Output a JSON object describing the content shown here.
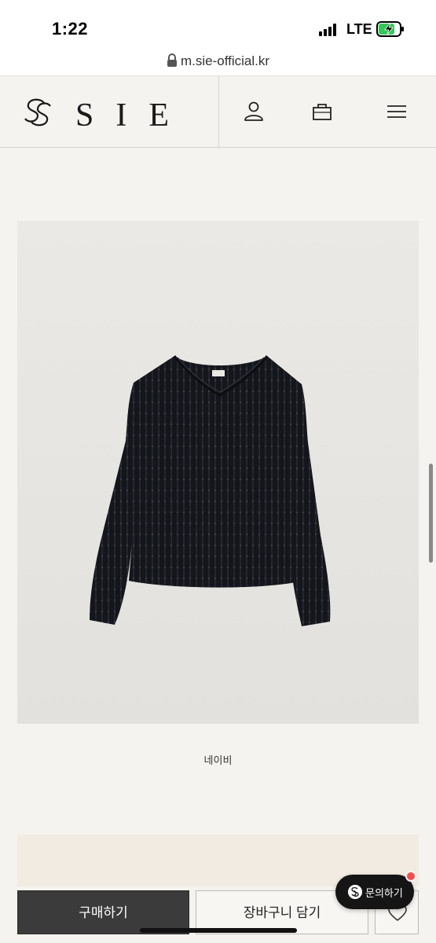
{
  "status_bar": {
    "time": "1:22",
    "network": "LTE",
    "icons": [
      "signal-icon",
      "battery-charging-icon"
    ]
  },
  "browser": {
    "url": "m.sie-official.kr",
    "icons": [
      "lock-icon"
    ]
  },
  "header": {
    "brand_name": "SIE",
    "icons": [
      "brand-logo-icon",
      "account-icon",
      "shopping-bag-icon",
      "menu-icon"
    ]
  },
  "product": {
    "image_icon": "navy-knit-sweater-photo",
    "color_label": "네이비"
  },
  "actions": {
    "buy_label": "구매하기",
    "cart_label": "장바구니 담기",
    "wishlist_icon": "heart-icon"
  },
  "chat": {
    "label": "문의하기",
    "accent_color": "#ec5050"
  },
  "colors": {
    "background": "#f4f3ef",
    "buy_button": "#3b3b3b",
    "chat_button": "#151515"
  }
}
